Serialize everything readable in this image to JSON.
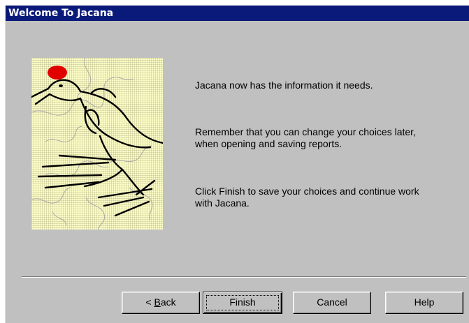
{
  "window": {
    "title": "Welcome To Jacana"
  },
  "illustration": {
    "icon": "jacana-bird-puzzle-illustration",
    "background_color": "#ffffc8",
    "crest_color": "#e00000"
  },
  "messages": {
    "line1": "Jacana now has the information it needs.",
    "line2": "Remember that you can change your choices later, when opening and saving reports.",
    "line3": "Click Finish to save your choices and continue work with Jacana."
  },
  "buttons": {
    "back_prefix": "< ",
    "back_accel": "B",
    "back_rest": "ack",
    "finish": "Finish",
    "cancel": "Cancel",
    "help": "Help"
  },
  "colors": {
    "titlebar": "#0a1a7a",
    "face": "#c0c0c0"
  }
}
